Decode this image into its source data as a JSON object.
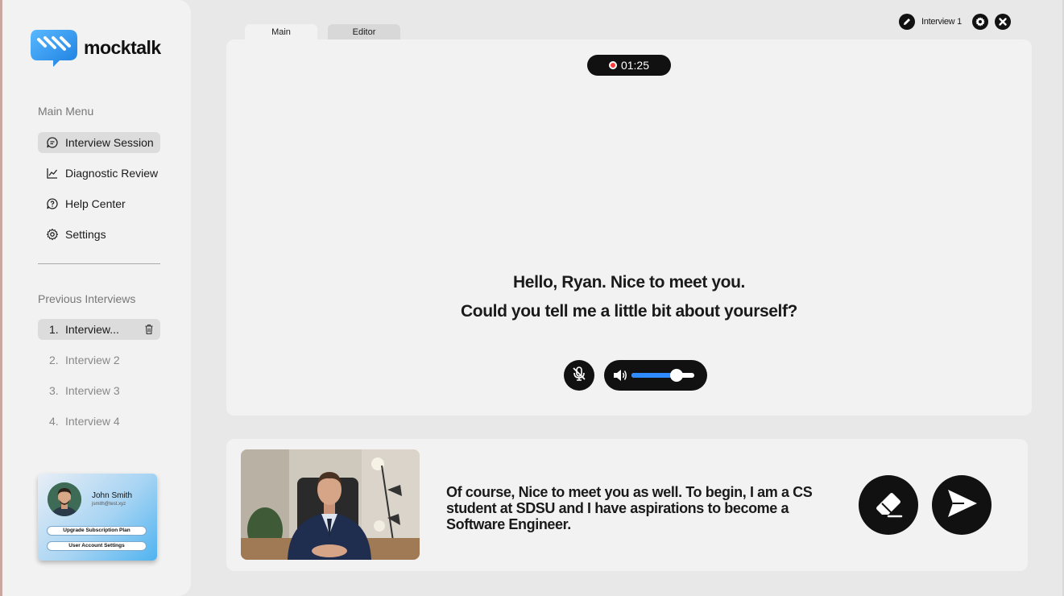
{
  "app": {
    "brand": "mocktalk"
  },
  "sidebar": {
    "main_menu_label": "Main Menu",
    "items": [
      {
        "label": "Interview Session",
        "icon": "chat-bubble-icon",
        "active": true
      },
      {
        "label": "Diagnostic Review",
        "icon": "trend-chart-icon",
        "active": false
      },
      {
        "label": "Help Center",
        "icon": "help-bubble-icon",
        "active": false
      },
      {
        "label": "Settings",
        "icon": "gear-icon",
        "active": false
      }
    ],
    "previous_label": "Previous Interviews",
    "previous": [
      {
        "num": "1.",
        "label": "Interview...",
        "active": true
      },
      {
        "num": "2.",
        "label": "Interview 2",
        "active": false
      },
      {
        "num": "3.",
        "label": "Interview 3",
        "active": false
      },
      {
        "num": "4.",
        "label": "Interview 4",
        "active": false
      }
    ]
  },
  "user": {
    "name": "John Smith",
    "email": "jsmith@test.xyz",
    "upgrade_label": "Upgrade Subscription Plan",
    "account_label": "User Account Settings"
  },
  "header": {
    "interview_name": "Interview 1",
    "icons": [
      "pencil-icon",
      "gear-icon",
      "close-icon"
    ]
  },
  "tabs": [
    {
      "label": "Main",
      "active": true
    },
    {
      "label": "Editor",
      "active": false
    }
  ],
  "session": {
    "timer": "01:25",
    "question_line1": "Hello, Ryan. Nice to meet you.",
    "question_line2": "Could you tell me a little bit about yourself?",
    "mic_muted": true,
    "volume_level": 0.72
  },
  "response": {
    "text": "Of course, Nice to meet you as well. To begin, I am a CS student at SDSU and I have aspirations to become a Software Engineer."
  },
  "colors": {
    "accent_blue": "#2f8cff",
    "record_red": "#ff3b3b",
    "dark": "#111111"
  }
}
